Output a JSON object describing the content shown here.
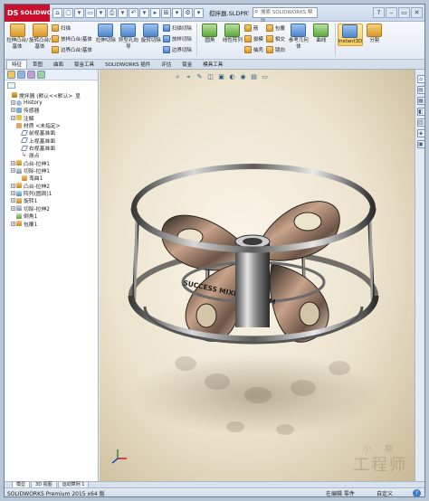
{
  "app": {
    "logo_text": "SOLIDWORKS",
    "logo_mark": "DS",
    "doc_title": "搅拌器.SLDPRT",
    "search_placeholder": "搜索 SOLIDWORKS 帮助"
  },
  "quick_access": [
    "⌂",
    "▢",
    "▾",
    "▭",
    "▾",
    "⎙",
    "▾",
    "↶",
    "▾",
    "▸",
    "⊞",
    "▾",
    "⚙",
    "▾"
  ],
  "window_buttons": [
    "?",
    "–",
    "▭",
    "✕"
  ],
  "ribbon": {
    "big_buttons": [
      {
        "label": "拉伸凸台/基体"
      },
      {
        "label": "旋转凸台/基体"
      }
    ],
    "col1": [
      "扫描",
      "放样凸台/基体",
      "边界凸台/基体"
    ],
    "big_buttons2": [
      {
        "label": "拉伸切除"
      },
      {
        "label": "异型孔向导"
      },
      {
        "label": "旋转切除"
      }
    ],
    "col2": [
      "扫描切除",
      "放样切除",
      "边界切除"
    ],
    "big_buttons3": [
      {
        "label": "圆角"
      },
      {
        "label": "线性阵列"
      }
    ],
    "col3": [
      "筋",
      "拔模",
      "抽壳"
    ],
    "col4": [
      "包覆",
      "相交",
      "镜向"
    ],
    "big_buttons4": [
      {
        "label": "参考几何体"
      },
      {
        "label": "曲线"
      },
      {
        "label": "Instant3D"
      },
      {
        "label": "分割"
      }
    ]
  },
  "tabs": [
    "特征",
    "草图",
    "曲面",
    "钣金工具",
    "SOLIDWORKS 插件",
    "评估",
    "钣金",
    "模具工具"
  ],
  "feature_tree": [
    {
      "label": "搅拌器  (默认<<默认>_显",
      "icon": "part",
      "depth": 0,
      "expander": "none"
    },
    {
      "label": "History",
      "icon": "hist",
      "depth": 1,
      "expander": "+"
    },
    {
      "label": "传感器",
      "icon": "sens",
      "depth": 1,
      "expander": "+"
    },
    {
      "label": "注解",
      "icon": "ann",
      "depth": 1,
      "expander": "+"
    },
    {
      "label": "材质 <未指定>",
      "icon": "mat",
      "depth": 1,
      "expander": "none"
    },
    {
      "label": "前视基准面",
      "icon": "plane",
      "depth": 2,
      "expander": "none"
    },
    {
      "label": "上视基准面",
      "icon": "plane",
      "depth": 2,
      "expander": "none"
    },
    {
      "label": "右视基准面",
      "icon": "plane",
      "depth": 2,
      "expander": "none"
    },
    {
      "label": "原点",
      "icon": "origin",
      "depth": 2,
      "expander": "none"
    },
    {
      "label": "凸台-拉伸1",
      "icon": "feat",
      "depth": 1,
      "expander": "+"
    },
    {
      "label": "切除-拉伸1",
      "icon": "cut",
      "depth": 1,
      "expander": "+"
    },
    {
      "label": "弯曲1",
      "icon": "feat",
      "depth": 2,
      "expander": "none"
    },
    {
      "label": "凸台-拉伸2",
      "icon": "feat",
      "depth": 1,
      "expander": "+"
    },
    {
      "label": "阵列(圆周)1",
      "icon": "pat",
      "depth": 1,
      "expander": "+"
    },
    {
      "label": "旋转1",
      "icon": "feat",
      "depth": 1,
      "expander": "+"
    },
    {
      "label": "切除-拉伸2",
      "icon": "cut",
      "depth": 1,
      "expander": "+"
    },
    {
      "label": "倒角1",
      "icon": "fil",
      "depth": 1,
      "expander": "none"
    },
    {
      "label": "包覆1",
      "icon": "feat",
      "depth": 1,
      "expander": "+"
    }
  ],
  "viewport": {
    "hud_icons": [
      "⌕",
      "⌖",
      "✎",
      "◫",
      "▣",
      "◐",
      "◉",
      "▤",
      "▭"
    ],
    "model_text": "SUCCESS MIXER SYSTEM",
    "watermark_top": "小 磨",
    "watermark_bottom": "工程师"
  },
  "task_pane_icons": [
    "⌂",
    "▤",
    "▦",
    "◧",
    "▥",
    "◈",
    "▣"
  ],
  "model_tabs": [
    "模型",
    "3D 视图",
    "运动算例 1"
  ],
  "status": {
    "left": "SOLIDWORKS Premium 2015 x64 版",
    "mid": "在编辑 零件",
    "right": "自定义",
    "help": "?"
  }
}
